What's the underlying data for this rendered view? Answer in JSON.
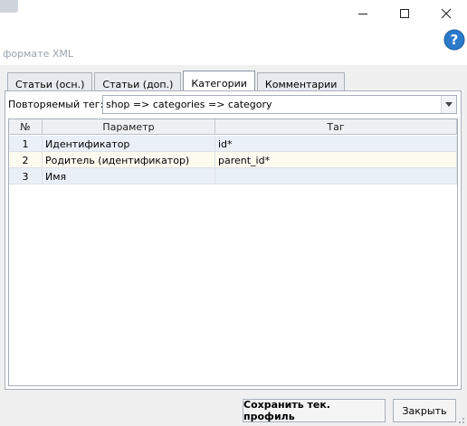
{
  "window": {
    "subtitle": "форматe XML"
  },
  "tabs": [
    {
      "label": "Статьи (осн.)",
      "active": false
    },
    {
      "label": "Статьи (доп.)",
      "active": false
    },
    {
      "label": "Категории",
      "active": true
    },
    {
      "label": "Комментарии",
      "active": false
    }
  ],
  "repeat_tag": {
    "label": "Повторяемый тег:",
    "value": "shop => categories => category"
  },
  "grid": {
    "columns": [
      "№",
      "Параметр",
      "Таг"
    ],
    "rows": [
      {
        "num": "1",
        "param": "Идентификатор",
        "tag": "id*"
      },
      {
        "num": "2",
        "param": "Родитель (идентификатор)",
        "tag": "parent_id*"
      },
      {
        "num": "3",
        "param": "Имя",
        "tag": ""
      }
    ]
  },
  "buttons": {
    "save": "Сохранить тек. профиль",
    "close": "Закрыть"
  },
  "colors": {
    "help_blue": "#2b79c9",
    "row_selected": "#eaf0f8",
    "row_alt": "#fdfbf0"
  }
}
